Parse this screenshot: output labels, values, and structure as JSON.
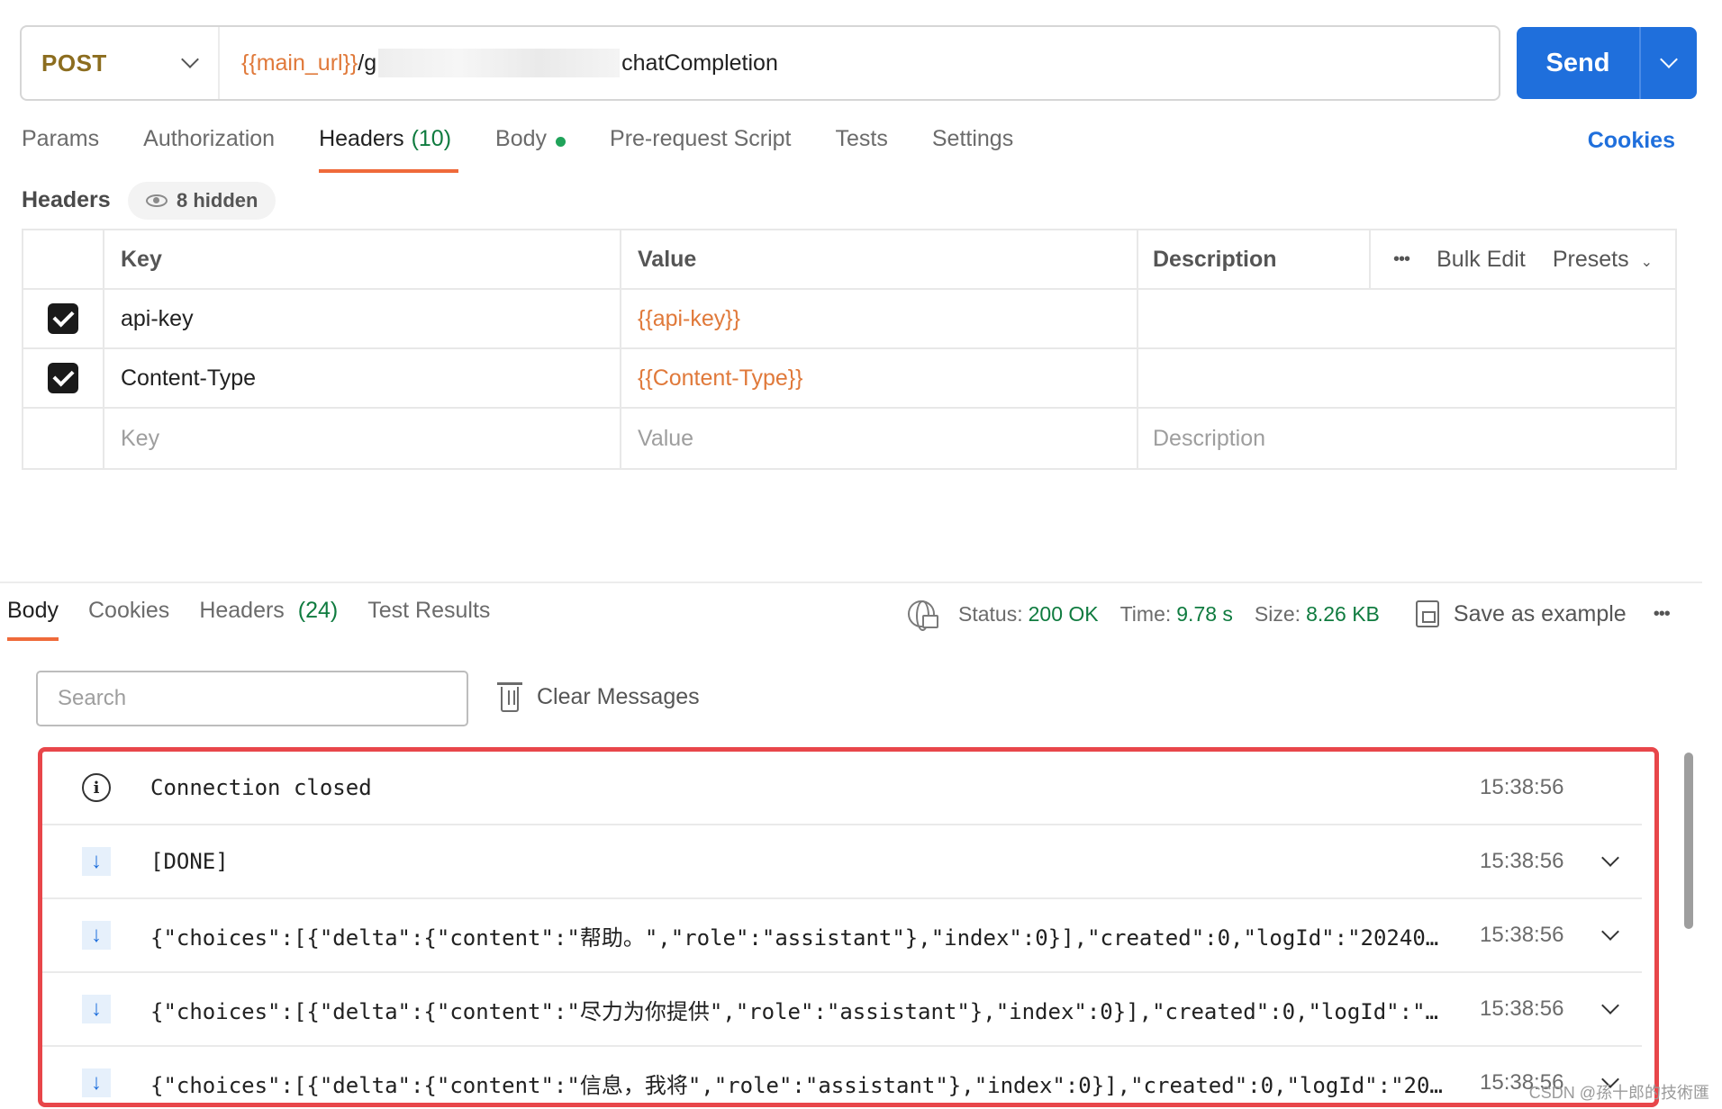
{
  "request": {
    "method": "POST",
    "url_var": "{{main_url}}",
    "url_prefix": "/g",
    "url_end": "chatCompletion",
    "send_label": "Send"
  },
  "req_tabs": {
    "params": "Params",
    "authorization": "Authorization",
    "headers": "Headers",
    "headers_count": "(10)",
    "body": "Body",
    "prerequest": "Pre-request Script",
    "tests": "Tests",
    "settings": "Settings",
    "cookies": "Cookies"
  },
  "headers_section": {
    "title": "Headers",
    "hidden": "8 hidden",
    "columns": {
      "key": "Key",
      "value": "Value",
      "description": "Description"
    },
    "actions": {
      "more": "•••",
      "bulk_edit": "Bulk Edit",
      "presets": "Presets"
    },
    "rows": [
      {
        "key": "api-key",
        "value": "{{api-key}}",
        "checked": true
      },
      {
        "key": "Content-Type",
        "value": "{{Content-Type}}",
        "checked": true
      }
    ],
    "placeholders": {
      "key": "Key",
      "value": "Value",
      "description": "Description"
    }
  },
  "response": {
    "tabs": {
      "body": "Body",
      "cookies": "Cookies",
      "headers": "Headers",
      "headers_count": "(24)",
      "test_results": "Test Results"
    },
    "status_label": "Status:",
    "status_value": "200 OK",
    "time_label": "Time:",
    "time_value": "9.78 s",
    "size_label": "Size:",
    "size_value": "8.26 KB",
    "save_example": "Save as example",
    "more": "•••",
    "search_placeholder": "Search",
    "clear_messages": "Clear Messages",
    "messages": [
      {
        "type": "info",
        "text": "Connection closed",
        "time": "15:38:56"
      },
      {
        "type": "received",
        "text": "[DONE]",
        "time": "15:38:56"
      },
      {
        "type": "received",
        "text": "{\"choices\":[{\"delta\":{\"content\":\"帮助。\",\"role\":\"assistant\"},\"index\":0}],\"created\":0,\"logId\":\"202401…",
        "time": "15:38:56"
      },
      {
        "type": "received",
        "text": "{\"choices\":[{\"delta\":{\"content\":\"尽力为你提供\",\"role\":\"assistant\"},\"index\":0}],\"created\":0,\"logId\":\"2…",
        "time": "15:38:56"
      },
      {
        "type": "received",
        "text": "{\"choices\":[{\"delta\":{\"content\":\"信息，我将\",\"role\":\"assistant\"},\"index\":0}],\"created\":0,\"logId\":\"20…",
        "time": "15:38:56"
      }
    ]
  },
  "watermark": "CSDN @孫十郎的技術匯",
  "colors": {
    "accent": "#1f6fdc",
    "tab_underline": "#ef6a3a",
    "variable": "#e0793a",
    "success": "#0f7b3f",
    "highlight_border": "#e8464a"
  }
}
